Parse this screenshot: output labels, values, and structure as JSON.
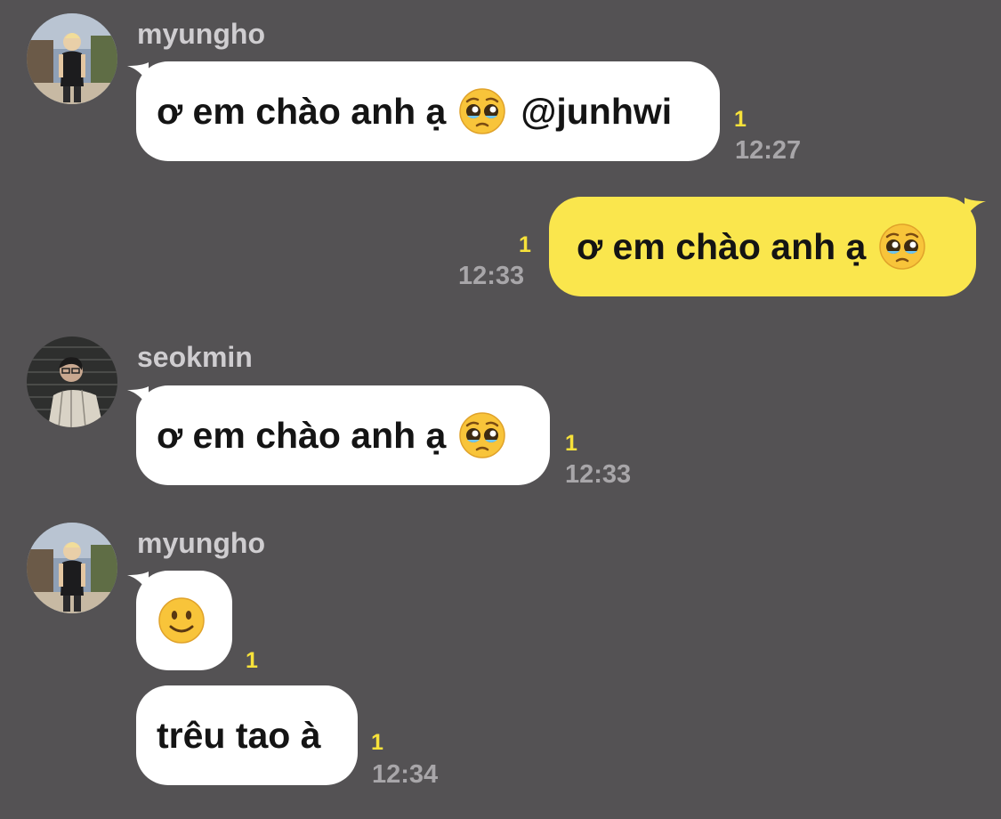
{
  "colors": {
    "background": "#545254",
    "incoming_bubble": "#ffffff",
    "outgoing_bubble": "#fae64d",
    "unread_count": "#f7e23a",
    "timestamp": "#a8a6a9",
    "sender_name": "#cfcdd0"
  },
  "messages": [
    {
      "sender": "myungho",
      "avatar": "profile-photo-myungho",
      "text": "ơ em chào anh ạ",
      "emoji": "pleading-face-icon",
      "mention": "@junhwi",
      "unread": "1",
      "time": "12:27"
    },
    {
      "direction": "outgoing",
      "text": "ơ em chào anh ạ",
      "emoji": "pleading-face-icon",
      "unread": "1",
      "time": "12:33"
    },
    {
      "sender": "seokmin",
      "avatar": "profile-photo-seokmin",
      "text": "ơ em chào anh ạ",
      "emoji": "pleading-face-icon",
      "unread": "1",
      "time": "12:33"
    },
    {
      "sender": "myungho",
      "avatar": "profile-photo-myungho",
      "emoji": "slightly-smiling-face-icon",
      "unread": "1"
    },
    {
      "text": "trêu tao à",
      "unread": "1",
      "time": "12:34"
    }
  ]
}
